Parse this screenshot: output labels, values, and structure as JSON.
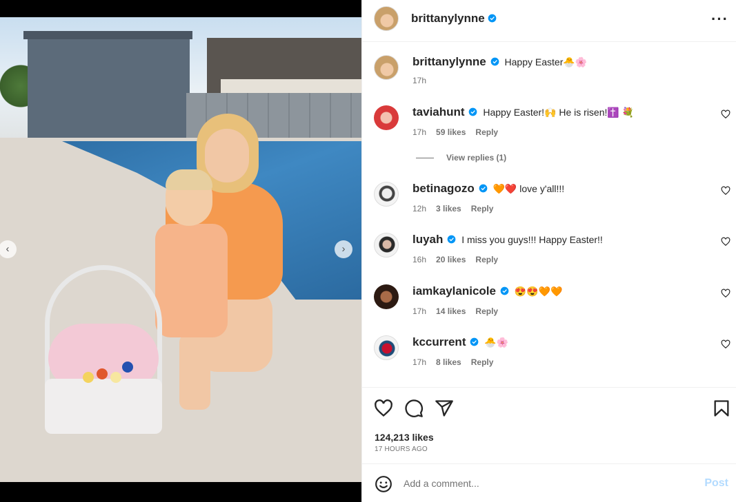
{
  "post": {
    "author": "brittanylynne",
    "caption_text": "Happy Easter🐣🌸",
    "caption_time": "17h",
    "likes": "124,213 likes",
    "time_ago": "17 HOURS AGO"
  },
  "comments": [
    {
      "user": "taviahunt",
      "text": "Happy Easter!🙌 He is risen!✝️ 💐",
      "time": "17h",
      "likes": "59 likes",
      "reply": "Reply"
    },
    {
      "user": "betinagozo",
      "text": "🧡❤️ love y'all!!!",
      "time": "12h",
      "likes": "3 likes",
      "reply": "Reply"
    },
    {
      "user": "luyah",
      "text": "I miss you guys!!! Happy Easter!!",
      "time": "16h",
      "likes": "20 likes",
      "reply": "Reply"
    },
    {
      "user": "iamkaylanicole",
      "text": "😍😍🧡🧡",
      "time": "17h",
      "likes": "14 likes",
      "reply": "Reply"
    },
    {
      "user": "kccurrent",
      "text": "🐣🌸",
      "time": "17h",
      "likes": "8 likes",
      "reply": "Reply"
    }
  ],
  "view_replies": "View replies (1)",
  "add_comment": {
    "placeholder": "Add a comment...",
    "post_label": "Post"
  },
  "colors": {
    "verified": "#0095f6",
    "post_disabled": "#b3dbff",
    "secondary_text": "#737373"
  },
  "icons": [
    "more-options-icon",
    "heart-icon",
    "comment-icon",
    "share-icon",
    "bookmark-icon",
    "emoji-icon",
    "verified-badge-icon",
    "carousel-prev-icon",
    "carousel-next-icon"
  ]
}
